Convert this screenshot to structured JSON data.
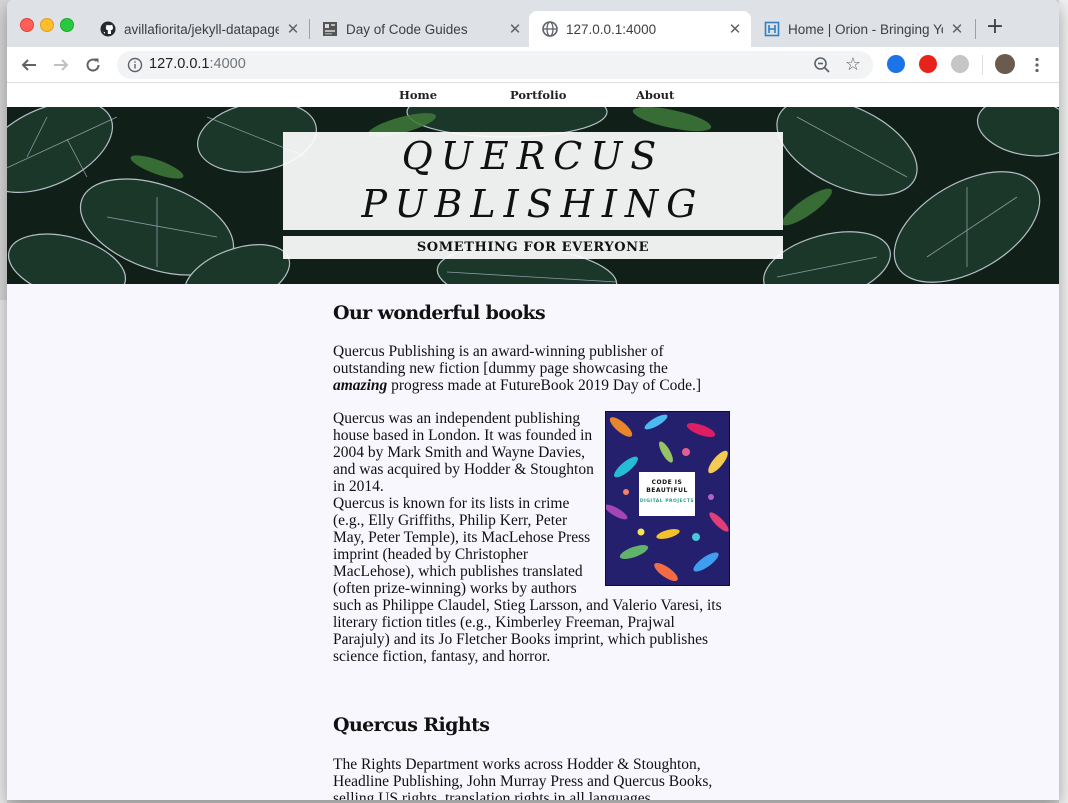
{
  "browser": {
    "tabs": [
      {
        "title": "avillafiorita/jekyll-datapage_",
        "icon": "github-icon",
        "active": false
      },
      {
        "title": "Day of Code Guides",
        "icon": "doc-icon",
        "active": false
      },
      {
        "title": "127.0.0.1:4000",
        "icon": "globe-icon",
        "active": true
      },
      {
        "title": "Home | Orion - Bringing You",
        "icon": "orion-icon",
        "active": false
      }
    ],
    "new_tab_label": "+",
    "address": {
      "host": "127.0.0.1",
      "port": ":4000"
    }
  },
  "site": {
    "nav": [
      "Home",
      "Portfolio",
      "About"
    ],
    "title_line1": "QUERCUS",
    "title_line2": "PUBLISHING",
    "tagline": "SOMETHING FOR EVERYONE"
  },
  "content": {
    "heading_books": "Our wonderful books",
    "intro_before": "Quercus Publishing is an award-winning publisher of outstanding new fiction [dummy page showcasing the ",
    "intro_emph": "amazing",
    "intro_after": " progress made at FutureBook 2019 Day of Code.]",
    "about_1": "Quercus was an independent publishing house based in London. It was founded in 2004 by Mark Smith and Wayne Davies, and was acquired by Hodder & Stoughton in 2014.",
    "about_2": "Quercus is known for its lists in crime (e.g., Elly Griffiths, Philip Kerr, Peter May, Peter Temple), its MacLehose Press imprint (headed by Christopher MacLehose), which publishes translated (often prize-winning) works by authors such as Philippe Claudel, Stieg Larsson, and Valerio Varesi, its literary fiction titles (e.g., Kimberley Freeman, Prajwal Parajuly) and its Jo Fletcher Books imprint, which publishes science fiction, fantasy, and horror.",
    "book_cover": {
      "title": "CODE IS BEAUTIFUL",
      "subtitle": "DIGITAL PROJECTS"
    },
    "heading_rights": "Quercus Rights",
    "rights_text": "The Rights Department works across Hodder & Stoughton, Headline Publishing, John Murray Press and Quercus Books, selling US rights, translation rights in all languages,"
  }
}
